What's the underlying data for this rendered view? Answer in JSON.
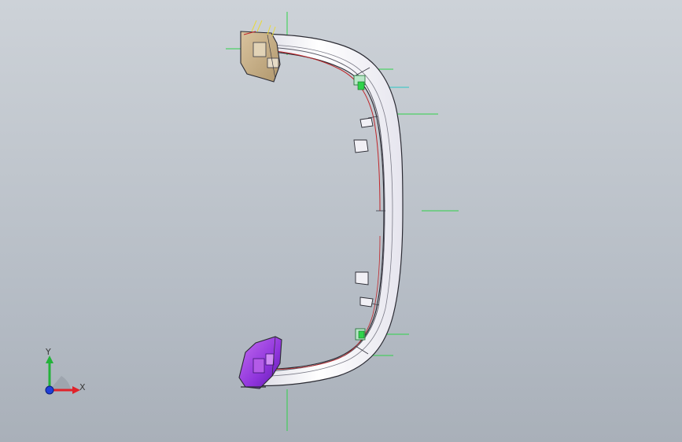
{
  "viewport": {
    "background_top": "#cdd2d8",
    "background_bottom": "#a9b0b9"
  },
  "model": {
    "name_icon": "bumper-part-model",
    "colors": {
      "body": "#f4f3f6",
      "edge": "#2b2b33",
      "inner_shadow": "#cfd0da",
      "red_edge": "#c0262a",
      "top_bracket": "#c9b089",
      "bottom_bracket": "#8a33d6",
      "bottom_bracket_light": "#c667f0",
      "guide_green": "#2fd24a",
      "guide_cyan": "#2bc6c4",
      "yellow_lines": "#e8d93a"
    }
  },
  "triad": {
    "x_label": "X",
    "y_label": "Y",
    "icons": [
      "x-axis-arrow-icon",
      "y-axis-arrow-icon",
      "z-axis-origin-icon"
    ],
    "colors": {
      "x": "#e0222a",
      "y": "#23b23a",
      "z": "#1f3fd8"
    }
  }
}
